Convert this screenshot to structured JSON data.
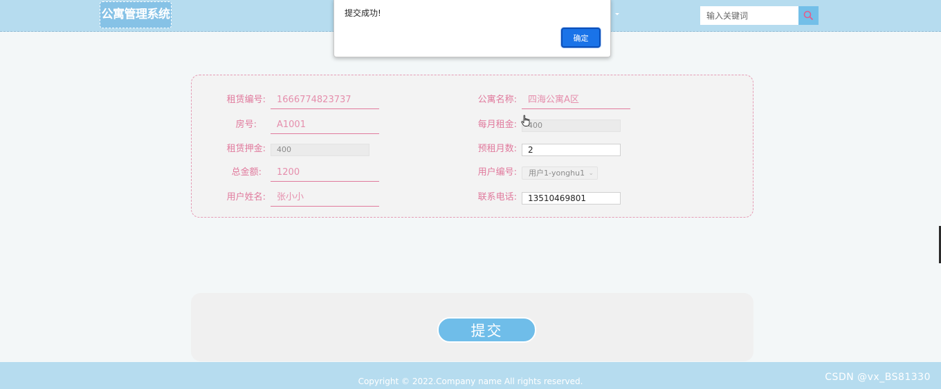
{
  "header": {
    "logo_text": "公寓管理系统",
    "search_placeholder": "输入关键词"
  },
  "form": {
    "rental_no": {
      "label": "租赁编号:",
      "value": "1666774823737"
    },
    "apartment_name": {
      "label": "公寓名称:",
      "value": "四海公寓A区"
    },
    "room_no": {
      "label": "房号:",
      "value": "A1001"
    },
    "monthly_rent": {
      "label": "每月租金:",
      "value": "400"
    },
    "deposit": {
      "label": "租赁押金:",
      "value": "400"
    },
    "months": {
      "label": "预租月数:",
      "value": "2"
    },
    "total": {
      "label": "总金额:",
      "value": "1200"
    },
    "user_no": {
      "label": "用户编号:",
      "value": "用户1-yonghu1"
    },
    "user_name": {
      "label": "用户姓名:",
      "value": "张小小"
    },
    "phone": {
      "label": "联系电话:",
      "value": "13510469801"
    }
  },
  "submit_label": "提交",
  "footer": {
    "copyright": "Copyright © 2022.Company name All rights reserved.",
    "watermark": "CSDN @vx_BS81330"
  },
  "alert": {
    "message": "提交成功!",
    "ok_label": "确定"
  },
  "colors": {
    "header_bg": "#b6dcef",
    "accent_blue": "#6fbde9",
    "label_pink": "#e0799c",
    "dialog_button": "#1a73e8"
  }
}
